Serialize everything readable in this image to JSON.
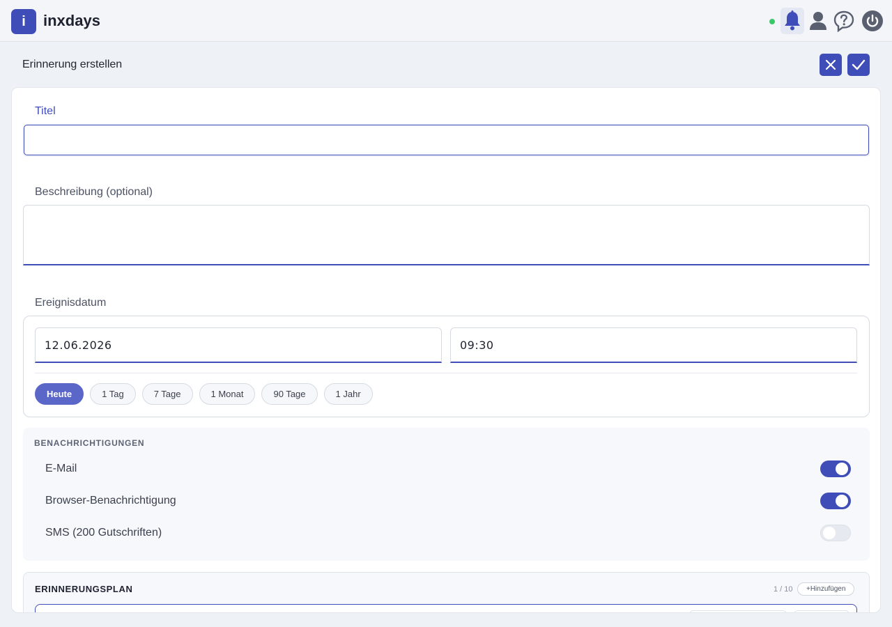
{
  "app": {
    "logo_letter": "i",
    "name": "inxdays"
  },
  "topbar": {
    "icons": [
      "bell-icon",
      "user-icon",
      "help-icon",
      "power-icon"
    ],
    "status": "online"
  },
  "page": {
    "title": "Erinnerung erstellen"
  },
  "form": {
    "title_label": "Titel",
    "title_value": "",
    "description_label": "Beschreibung (optional)",
    "description_value": "",
    "date_label": "Ereignisdatum",
    "date_value": "12.06.2026",
    "time_value": "09:30",
    "quick_ranges": [
      "Heute",
      "1 Tag",
      "7 Tage",
      "1 Monat",
      "90 Tage",
      "1 Jahr"
    ],
    "active_range": "Heute"
  },
  "notifications": {
    "title": "BENACHRICHTIGUNGEN",
    "items": [
      {
        "label": "E-Mail",
        "enabled": true
      },
      {
        "label": "Browser-Benachrichtigung",
        "enabled": true
      },
      {
        "label": "SMS (200 Gutschriften)",
        "enabled": false
      }
    ]
  },
  "plan": {
    "title": "ERINNERUNGSPLAN",
    "count": "1 / 10",
    "add_label": "+Hinzufügen"
  },
  "colors": {
    "accent": "#3f4db8",
    "chip_active": "#5a66c8",
    "status": "#3ec66b"
  }
}
